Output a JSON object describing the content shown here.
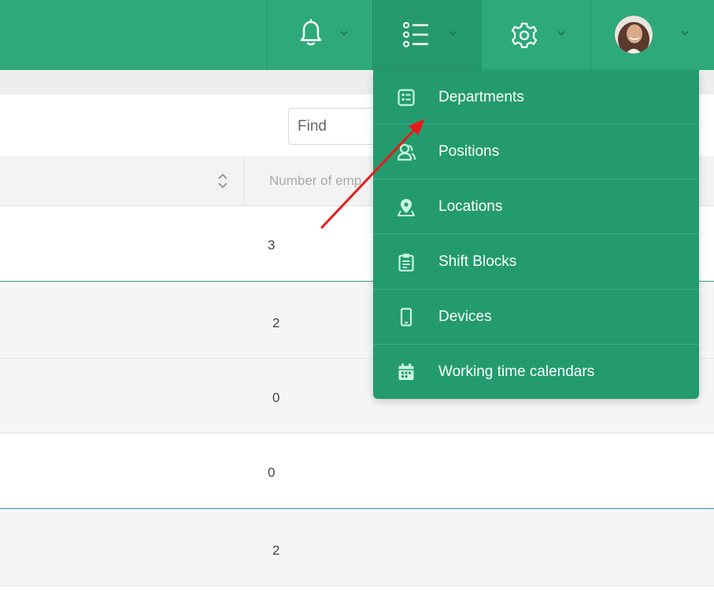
{
  "topbar": {
    "sections": [
      {
        "name": "notifications",
        "icon": "bell-icon"
      },
      {
        "name": "lists",
        "icon": "list-icon"
      },
      {
        "name": "settings",
        "icon": "gear-icon"
      },
      {
        "name": "profile",
        "icon": "avatar"
      }
    ],
    "colors": {
      "bar": "#2eaa7a",
      "active": "#279a6d",
      "dropdown": "#239b6e"
    }
  },
  "search": {
    "placeholder": "Find"
  },
  "table": {
    "column_header": "Number of emp",
    "rows": [
      "3",
      "2",
      "0",
      "0",
      "2"
    ]
  },
  "dropdown": {
    "items": [
      {
        "label": "Departments",
        "icon": "department-card-icon"
      },
      {
        "label": "Positions",
        "icon": "positions-users-icon"
      },
      {
        "label": "Locations",
        "icon": "location-pin-icon"
      },
      {
        "label": "Shift Blocks",
        "icon": "clipboard-icon"
      },
      {
        "label": "Devices",
        "icon": "mobile-device-icon"
      },
      {
        "label": "Working time calendars",
        "icon": "calendar-icon"
      }
    ]
  },
  "annotation": {
    "color": "#e81b1b"
  }
}
